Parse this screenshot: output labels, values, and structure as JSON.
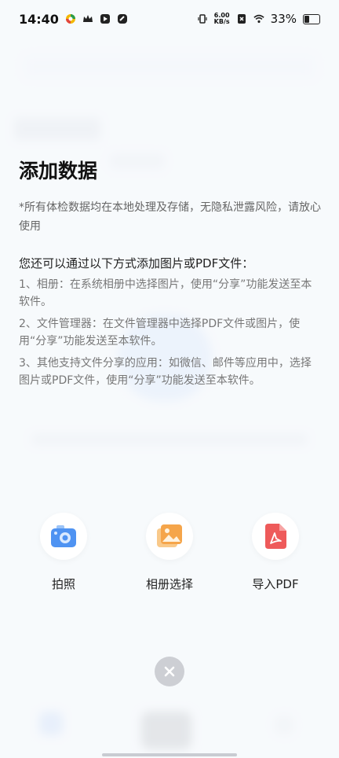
{
  "status_bar": {
    "time": "14:40",
    "net_speed_value": "6.00",
    "net_speed_unit": "KB/s",
    "battery_percent": "33%"
  },
  "sheet": {
    "title": "添加数据",
    "privacy_note": "*所有体检数据均在本地处理及存储，无隐私泄露风险，请放心使用",
    "methods_heading": "您还可以通过以下方式添加图片或PDF文件：",
    "methods": [
      "1、相册：在系统相册中选择图片，使用“分享”功能发送至本软件。",
      "2、文件管理器：在文件管理器中选择PDF文件或图片，使用“分享”功能发送至本软件。",
      "3、其他支持文件分享的应用：如微信、邮件等应用中，选择图片或PDF文件，使用“分享”功能发送至本软件。"
    ]
  },
  "actions": {
    "camera": "拍照",
    "album": "相册选择",
    "pdf": "导入PDF"
  },
  "icons": {
    "camera": "camera-icon",
    "album": "photo-album-icon",
    "pdf": "pdf-file-icon",
    "close": "close-icon"
  },
  "colors": {
    "camera_blue": "#4f93f2",
    "album_orange": "#f5a54a",
    "pdf_red": "#ee5a5a"
  }
}
